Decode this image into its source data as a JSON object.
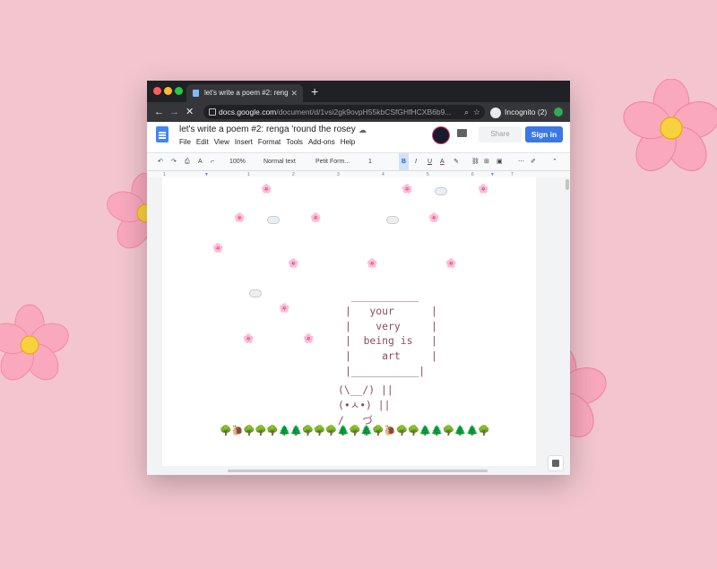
{
  "browser": {
    "tab_title": "let's write a poem #2: renga 'ro",
    "tab_close": "✕",
    "new_tab": "+",
    "back": "←",
    "forward": "→",
    "stop": "✕",
    "url_domain": "docs.google.com",
    "url_path": "/document/d/1vsi2gk9ovpH55kbCSfGHfHCXB6b9...",
    "profile_label": "Incognito (2)"
  },
  "doc": {
    "title": "let's write a poem #2: renga 'round the rosey",
    "menus": [
      "File",
      "Edit",
      "View",
      "Insert",
      "Format",
      "Tools",
      "Add-ons",
      "Help"
    ],
    "share_label": "Share",
    "signin_label": "Sign in"
  },
  "toolbar": {
    "undo": "↶",
    "redo": "↷",
    "print": "⎙",
    "spell": "A",
    "paint": "⌐",
    "zoom": "100%",
    "style": "Normal text",
    "font": "Petit Form...",
    "size": "1",
    "bold": "B",
    "italic": "I",
    "underline": "U",
    "text_color": "A",
    "more": "⋯",
    "collapse": "⌃"
  },
  "ruler_marks": [
    "1",
    "1",
    "2",
    "3",
    "4",
    "5",
    "6",
    "7"
  ],
  "poem": {
    "box_top": " ___________",
    "line1": "|   your      |",
    "line2": "|    very     |",
    "line3": "|  being is   |",
    "line4": "|     art     |",
    "box_bottom": "|___________|",
    "bunny1": "(\\__/) ||",
    "bunny2": "(•ㅅ•) ||",
    "bunny3": "/   づ"
  },
  "decor": {
    "petal": "🌸",
    "tree": "🌳",
    "pine": "🌲",
    "snail": "🐌",
    "tree_row": "🌳🐌🌳🌳🌳🌲🌲🌳🌳🌳🌲🌳🌲🌳🐌🌳🌳🌲🌲🌳🌲🌲🌳"
  },
  "colors": {
    "background": "#f3c6cf",
    "signin": "#3b78e7",
    "ascii_text": "#8e4a63"
  }
}
